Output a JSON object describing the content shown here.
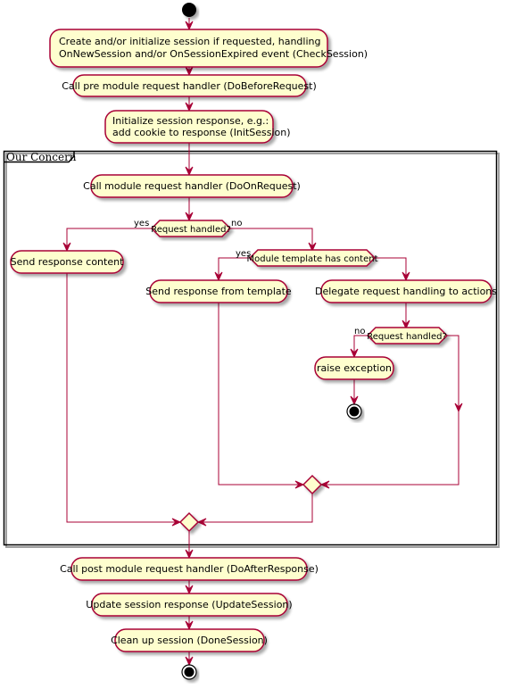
{
  "diagram": {
    "type": "activity",
    "colors": {
      "activity_fill": "#fefece",
      "border": "#a80036",
      "edge": "#a80036",
      "frame": "#000000",
      "node": "#000000"
    },
    "activities": {
      "check_session": [
        "Create and/or initialize session if requested, handling",
        "OnNewSession and/or OnSessionExpired event (CheckSession)"
      ],
      "do_before_request": "Call pre module request handler (DoBeforeRequest)",
      "init_session": [
        "Initialize session response, e.g.:",
        "add cookie to response (InitSession)"
      ],
      "do_on_request": "Call module request handler (DoOnRequest)",
      "send_response_content": "Send response content",
      "send_from_template": "Send response from template",
      "delegate_actions": "Delegate request handling to actions",
      "raise_exception": "raise exception",
      "do_after_response": "Call post module request handler (DoAfterResponse)",
      "update_session": "Update session response (UpdateSession)",
      "done_session": "Clean up session (DoneSession)"
    },
    "decisions": {
      "request_handled_1": {
        "label": "Request handled?",
        "yes": "yes",
        "no": "no"
      },
      "template_has_content": {
        "label": "Module template has content",
        "yes": "yes"
      },
      "request_handled_2": {
        "label": "Request handled?",
        "no": "no"
      }
    },
    "frame": {
      "title": "Our Concern"
    }
  }
}
